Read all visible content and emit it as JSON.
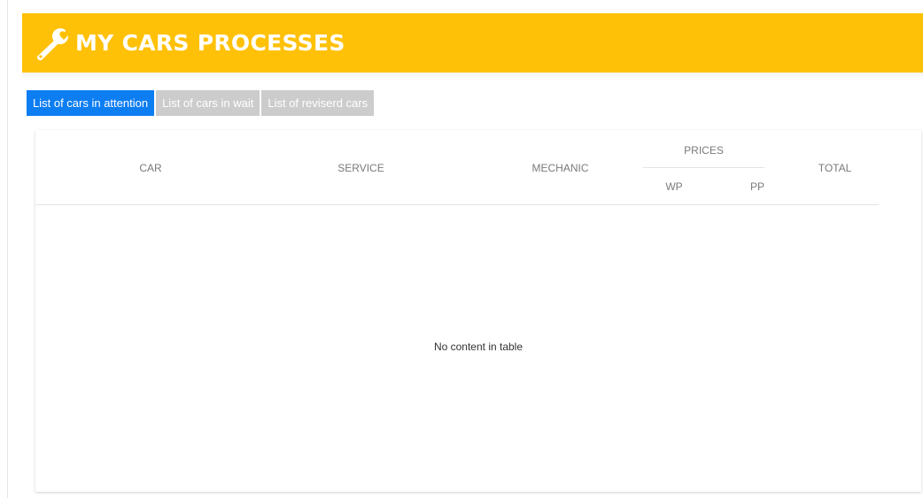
{
  "header": {
    "title": "MY CARS PROCESSES",
    "icon": "wrench-icon",
    "bg_color": "#ffc107"
  },
  "tabs": [
    {
      "label": "List of cars in attention",
      "active": true
    },
    {
      "label": "List of cars in wait",
      "active": false
    },
    {
      "label": "List of reviserd cars",
      "active": false
    }
  ],
  "colors": {
    "active_tab": "#0d7df2",
    "inactive_tab": "#cccccc"
  },
  "table": {
    "columns": {
      "car": "CAR",
      "service": "SERVICE",
      "mechanic": "MECHANIC",
      "prices": "PRICES",
      "wp": "WP",
      "pp": "PP",
      "total": "TOTAL"
    },
    "empty_message": "No content in table"
  }
}
